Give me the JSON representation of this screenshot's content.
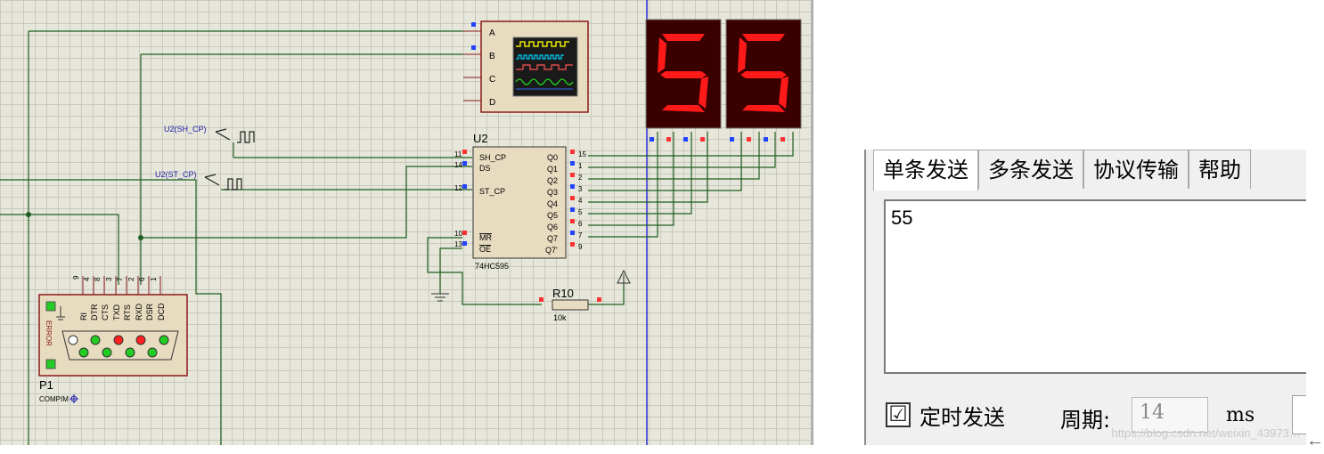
{
  "schematic": {
    "scope_pins": [
      "A",
      "B",
      "C",
      "D"
    ],
    "display_digits": [
      "5",
      "5"
    ],
    "generator_labels": [
      "U2(SH_CP)",
      "U2(ST_CP)"
    ],
    "ic": {
      "ref": "U2",
      "part": "74HC595",
      "left_pins": [
        {
          "num": "11",
          "name": "SH_CP"
        },
        {
          "num": "14",
          "name": "DS"
        },
        {
          "num": "12",
          "name": "ST_CP"
        },
        {
          "num": "10",
          "name": "MR"
        },
        {
          "num": "13",
          "name": "OE"
        }
      ],
      "right_pins": [
        {
          "num": "15",
          "name": "Q0"
        },
        {
          "num": "1",
          "name": "Q1"
        },
        {
          "num": "2",
          "name": "Q2"
        },
        {
          "num": "3",
          "name": "Q3"
        },
        {
          "num": "4",
          "name": "Q4"
        },
        {
          "num": "5",
          "name": "Q5"
        },
        {
          "num": "6",
          "name": "Q6"
        },
        {
          "num": "7",
          "name": "Q7"
        },
        {
          "num": "9",
          "name": "Q7'"
        }
      ]
    },
    "resistor": {
      "ref": "R10",
      "value": "10k"
    },
    "port": {
      "ref": "P1",
      "part": "COMPIM",
      "error_label": "ERROR",
      "pin_nums": [
        "9",
        "4",
        "8",
        "3",
        "7",
        "2",
        "6",
        "1"
      ],
      "signals": [
        "RI",
        "DTR",
        "CTS",
        "TXD",
        "RTS",
        "RXD",
        "DSR",
        "DCD"
      ]
    }
  },
  "tool": {
    "tabs": [
      "单条发送",
      "多条发送",
      "协议传输",
      "帮助"
    ],
    "send_text": "55",
    "timed_send_label": "定时发送",
    "timed_send_checked": "☑",
    "period_label": "周期:",
    "period_value": "14",
    "period_unit": "ms",
    "watermark": "https://blog.csdn.net/weixin_43973…",
    "arrow": "←"
  },
  "colors": {
    "wire": "#1f5f1f",
    "segment_on": "#ff1a1a",
    "display_bg": "#3a0000",
    "component_fill": "#e8dcc0",
    "component_border": "#8b1a1a"
  }
}
